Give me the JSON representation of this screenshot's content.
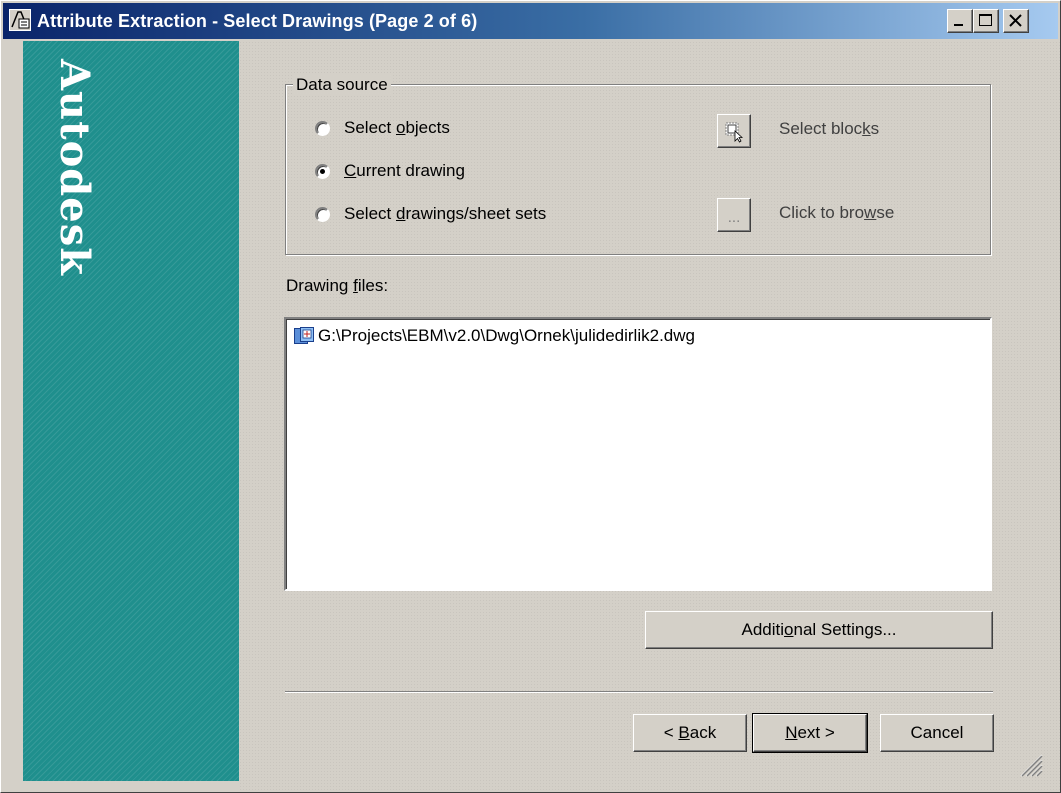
{
  "window": {
    "title": "Attribute Extraction - Select Drawings (Page 2 of 6)"
  },
  "brand": {
    "text": "Autodesk"
  },
  "data_source": {
    "legend": "Data source",
    "options": [
      {
        "pre": "Select ",
        "key": "o",
        "post": "bjects",
        "selected": false
      },
      {
        "pre": "",
        "key": "C",
        "post": "urrent drawing",
        "selected": true
      },
      {
        "pre": "Select ",
        "key": "d",
        "post": "rawings/sheet sets",
        "selected": false
      }
    ],
    "select_blocks": {
      "pre": "Select bloc",
      "key": "k",
      "post": "s"
    },
    "browse": {
      "pre": "Click to bro",
      "key": "w",
      "post": "se",
      "button_label": "..."
    }
  },
  "files": {
    "label_pre": "Drawing ",
    "label_key": "f",
    "label_post": "iles:",
    "items": [
      "G:\\Projects\\EBM\\v2.0\\Dwg\\Ornek\\julidedirlik2.dwg"
    ]
  },
  "buttons": {
    "additional": {
      "pre": "Additi",
      "key": "o",
      "post": "nal Settings..."
    },
    "back": {
      "pre": "< ",
      "key": "B",
      "post": "ack"
    },
    "next": {
      "pre": "",
      "key": "N",
      "post": "ext >"
    },
    "cancel": "Cancel"
  },
  "colors": {
    "title_start": "#0a246a",
    "title_end": "#a6caf0",
    "brand_panel": "#1f8f8d",
    "face": "#d4d0c8"
  }
}
